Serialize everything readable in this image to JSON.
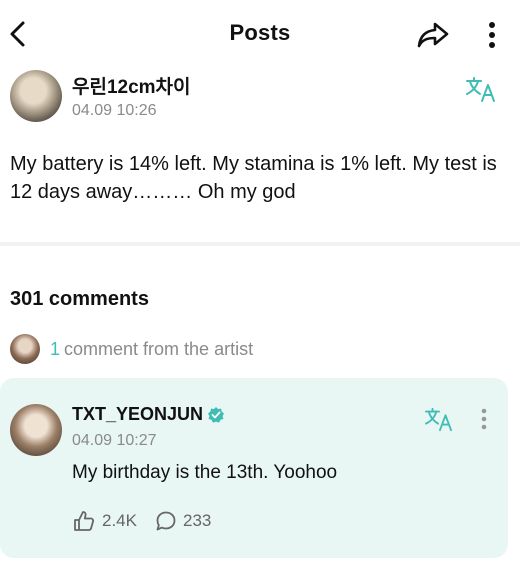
{
  "header": {
    "title": "Posts",
    "back_icon": "chevron-left-icon",
    "share_icon": "share-icon",
    "more_icon": "more-vertical-icon"
  },
  "post": {
    "author": "우린12cm차이",
    "time": "04.09 10:26",
    "translate_icon": "translate-icon",
    "body": "My battery is 14% left. My stamina is 1% left. My test is 12 days away……… Oh my god"
  },
  "comments": {
    "count_label": "301 comments",
    "artist_summary": {
      "count": "1",
      "text": "comment from the artist"
    },
    "featured": {
      "author": "TXT_YEONJUN",
      "verified_icon": "verified-badge-icon",
      "time": "04.09 10:27",
      "body": "My birthday is the 13th. Yoohoo",
      "likes": "2.4K",
      "replies": "233",
      "like_icon": "like-icon",
      "reply_icon": "comment-icon"
    }
  },
  "colors": {
    "accent": "#3fbdb5",
    "card_background": "#e8f6f4",
    "muted_text": "#8a8a8a"
  }
}
